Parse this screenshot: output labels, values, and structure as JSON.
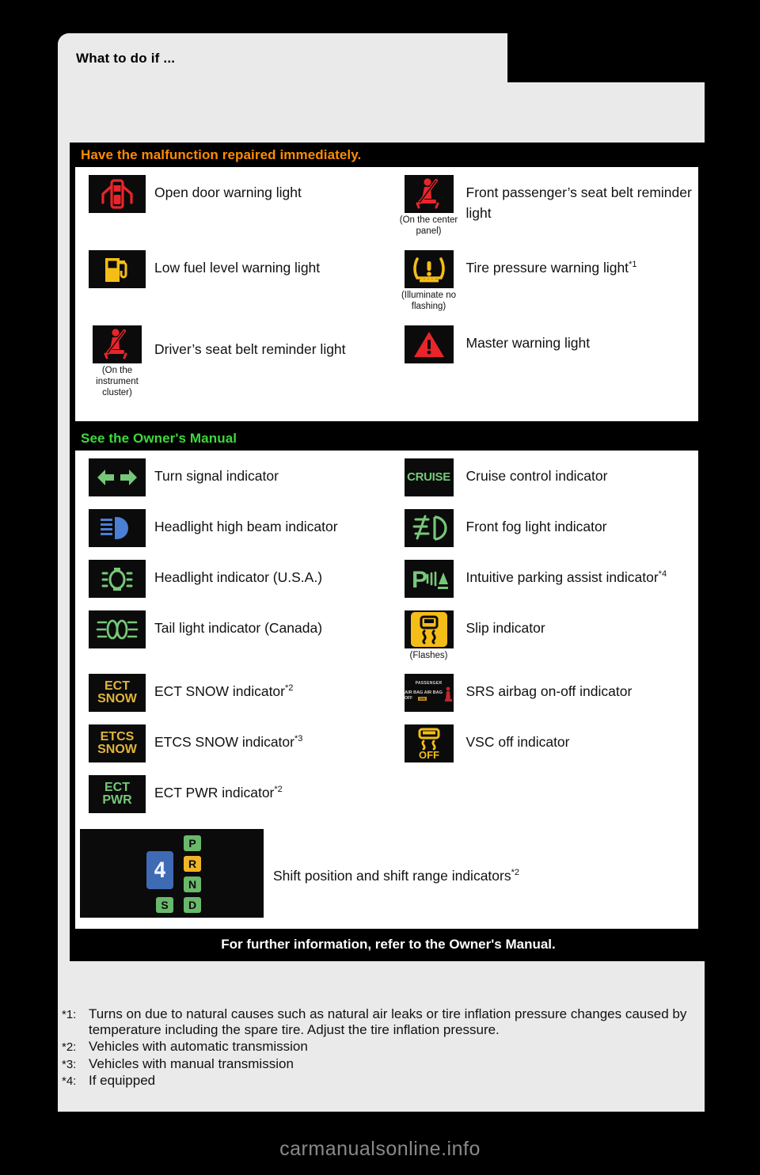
{
  "page": {
    "title": "What to do if ...",
    "watermark": "carmanualsonline.info"
  },
  "sections": [
    {
      "id": "malfunction",
      "heading": "Have the malfunction repaired immediately.",
      "heading_color": "#ff8c00",
      "rows": [
        {
          "left": {
            "icon": "open-door-warning-icon",
            "label": "Open door warning light",
            "note": ""
          },
          "right": {
            "icon": "passenger-seatbelt-reminder-icon",
            "label": "Front passenger’s seat belt reminder light",
            "note": "(On the center panel)"
          }
        },
        {
          "left": {
            "icon": "low-fuel-warning-icon",
            "label": "Low fuel level warning light",
            "note": ""
          },
          "right": {
            "icon": "tire-pressure-warning-icon",
            "label": "Tire pressure warning light",
            "sup": "*1",
            "note": "(Illuminate no flashing)"
          }
        },
        {
          "left": {
            "icon": "driver-seatbelt-reminder-icon",
            "label": "Driver’s seat belt reminder light",
            "note": "(On the instrument cluster)"
          },
          "right": {
            "icon": "master-warning-icon",
            "label": "Master warning light",
            "note": ""
          }
        }
      ]
    },
    {
      "id": "owners-manual",
      "heading": "See the Owner's Manual",
      "heading_color": "#3dd93d",
      "rows": [
        {
          "left": {
            "icon": "turn-signal-indicator-icon",
            "label": "Turn signal indicator",
            "note": ""
          },
          "right": {
            "icon": "cruise-control-indicator-icon",
            "label": "Cruise control indicator",
            "note": ""
          }
        },
        {
          "left": {
            "icon": "high-beam-indicator-icon",
            "label": "Headlight high beam indicator",
            "note": ""
          },
          "right": {
            "icon": "front-fog-light-indicator-icon",
            "label": "Front fog light indicator",
            "note": ""
          }
        },
        {
          "left": {
            "icon": "headlight-indicator-icon",
            "label": "Headlight indicator (U.S.A.)",
            "note": ""
          },
          "right": {
            "icon": "intuitive-parking-assist-icon",
            "label": "Intuitive parking assist indicator",
            "sup": "*4",
            "note": ""
          }
        },
        {
          "left": {
            "icon": "tail-light-indicator-icon",
            "label": "Tail light indicator (Canada)",
            "note": ""
          },
          "right": {
            "icon": "slip-indicator-icon",
            "label": "Slip indicator",
            "note": "(Flashes)"
          }
        },
        {
          "left": {
            "icon": "ect-snow-indicator-icon",
            "label": "ECT SNOW indicator",
            "sup": "*2",
            "note": ""
          },
          "right": {
            "icon": "srs-airbag-on-off-indicator-icon",
            "label": "SRS airbag on-off indicator",
            "note": ""
          }
        },
        {
          "left": {
            "icon": "etcs-snow-indicator-icon",
            "label": "ETCS SNOW indicator",
            "sup": "*3",
            "note": ""
          },
          "right": {
            "icon": "vsc-off-indicator-icon",
            "label": "VSC off indicator",
            "note": ""
          }
        },
        {
          "left": {
            "icon": "ect-pwr-indicator-icon",
            "label": "ECT PWR indicator",
            "sup": "*2",
            "note": ""
          },
          "right": null
        }
      ],
      "wide_row": {
        "icon": "shift-position-indicator-icon",
        "label": "Shift position and shift range indicators",
        "sup": "*2"
      },
      "footer": "For further information, refer to the Owner's Manual."
    }
  ],
  "icon_text": {
    "cruise": "CRUISE",
    "ect_snow_l1": "ECT",
    "ect_snow_l2": "SNOW",
    "etcs_snow_l1": "ETCS",
    "etcs_snow_l2": "SNOW",
    "ect_pwr_l1": "ECT",
    "ect_pwr_l2": "PWR",
    "vsc_off": "OFF",
    "parking_p": "P",
    "airbag_l1": "PASSENGER",
    "airbag_l2": "AIR BAG  AIR BAG",
    "airbag_l3": "OFF",
    "airbag_l4": "ON",
    "shift_gear": "4",
    "shift_p": "P",
    "shift_r": "R",
    "shift_n": "N",
    "shift_d": "D",
    "shift_s": "S"
  },
  "colors": {
    "orange": "#ff8c00",
    "green": "#3dd93d",
    "warn_red": "#e8252a",
    "amber": "#f5bd18",
    "indicator_green": "#76c878",
    "blue": "#3f6bb5"
  },
  "footnotes": [
    {
      "marker": "*1:",
      "text": "Turns on due to natural causes such as natural air leaks or tire inflation pressure changes caused by temperature including the spare tire. Adjust the tire inflation pressure."
    },
    {
      "marker": "*2:",
      "text": "Vehicles with automatic transmission"
    },
    {
      "marker": "*3:",
      "text": "Vehicles with manual transmission"
    },
    {
      "marker": "*4:",
      "text": "If equipped"
    }
  ]
}
